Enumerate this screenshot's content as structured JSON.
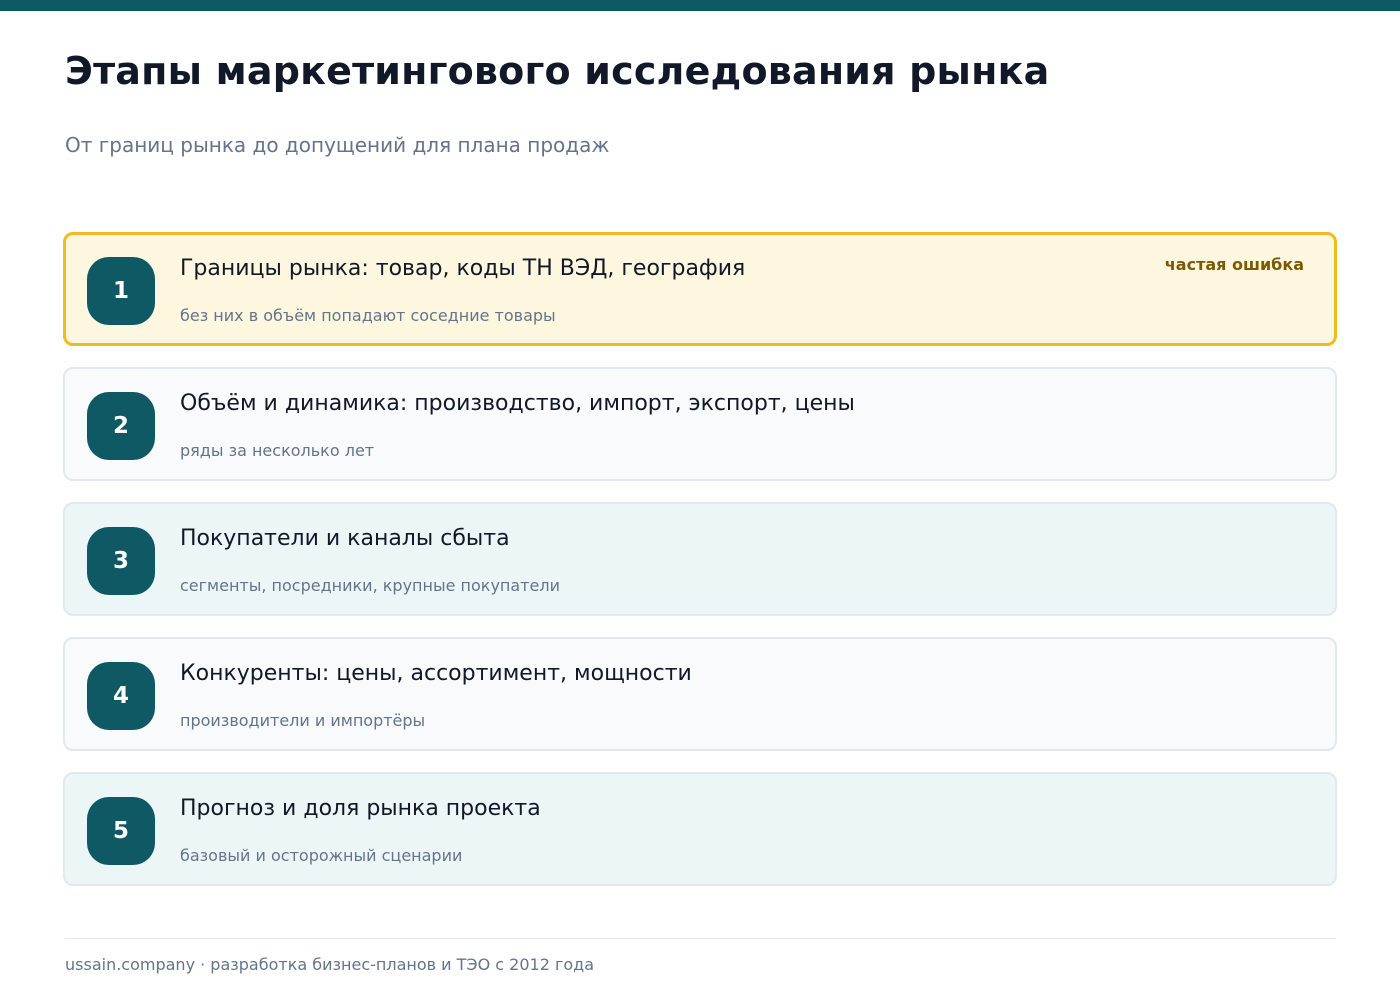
{
  "header": {
    "title": "Этапы маркетингового исследования рынка",
    "subtitle": "От границ рынка до допущений для плана продаж"
  },
  "steps": [
    {
      "number": "1",
      "title": "Границы рынка: товар, коды ТН ВЭД, география",
      "subtitle": "без них в объём попадают соседние товары",
      "tag": "частая ошибка"
    },
    {
      "number": "2",
      "title": "Объём и динамика: производство, импорт, экспорт, цены",
      "subtitle": "ряды за несколько лет"
    },
    {
      "number": "3",
      "title": "Покупатели и каналы сбыта",
      "subtitle": "сегменты, посредники, крупные покупатели"
    },
    {
      "number": "4",
      "title": "Конкуренты: цены, ассортимент, мощности",
      "subtitle": "производители и импортёры"
    },
    {
      "number": "5",
      "title": "Прогноз и доля рынка проекта",
      "subtitle": "базовый и осторожный сценарии"
    }
  ],
  "footer": {
    "text": "ussain.company · разработка бизнес-планов и ТЭО с 2012 года"
  },
  "colors": {
    "accent": "#0e5964",
    "highlight_border": "#f0bb1d",
    "highlight_bg": "#fef7df",
    "warning_text": "#7c5a00"
  }
}
